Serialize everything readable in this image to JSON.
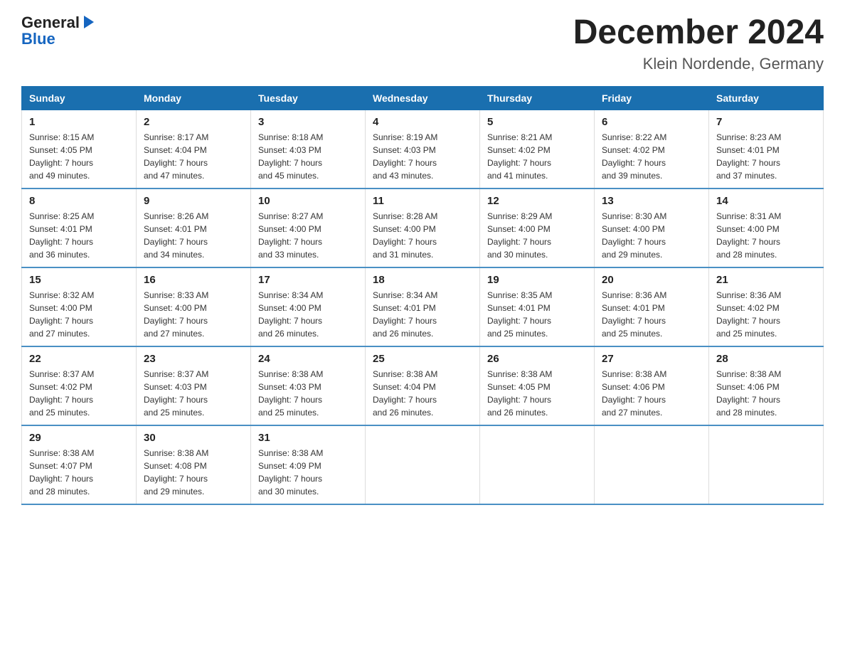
{
  "logo": {
    "general": "General",
    "arrow": "▶",
    "blue": "Blue"
  },
  "title": {
    "month_year": "December 2024",
    "location": "Klein Nordende, Germany"
  },
  "days_header": [
    "Sunday",
    "Monday",
    "Tuesday",
    "Wednesday",
    "Thursday",
    "Friday",
    "Saturday"
  ],
  "weeks": [
    [
      {
        "day": "1",
        "sunrise": "8:15 AM",
        "sunset": "4:05 PM",
        "daylight": "7 hours and 49 minutes."
      },
      {
        "day": "2",
        "sunrise": "8:17 AM",
        "sunset": "4:04 PM",
        "daylight": "7 hours and 47 minutes."
      },
      {
        "day": "3",
        "sunrise": "8:18 AM",
        "sunset": "4:03 PM",
        "daylight": "7 hours and 45 minutes."
      },
      {
        "day": "4",
        "sunrise": "8:19 AM",
        "sunset": "4:03 PM",
        "daylight": "7 hours and 43 minutes."
      },
      {
        "day": "5",
        "sunrise": "8:21 AM",
        "sunset": "4:02 PM",
        "daylight": "7 hours and 41 minutes."
      },
      {
        "day": "6",
        "sunrise": "8:22 AM",
        "sunset": "4:02 PM",
        "daylight": "7 hours and 39 minutes."
      },
      {
        "day": "7",
        "sunrise": "8:23 AM",
        "sunset": "4:01 PM",
        "daylight": "7 hours and 37 minutes."
      }
    ],
    [
      {
        "day": "8",
        "sunrise": "8:25 AM",
        "sunset": "4:01 PM",
        "daylight": "7 hours and 36 minutes."
      },
      {
        "day": "9",
        "sunrise": "8:26 AM",
        "sunset": "4:01 PM",
        "daylight": "7 hours and 34 minutes."
      },
      {
        "day": "10",
        "sunrise": "8:27 AM",
        "sunset": "4:00 PM",
        "daylight": "7 hours and 33 minutes."
      },
      {
        "day": "11",
        "sunrise": "8:28 AM",
        "sunset": "4:00 PM",
        "daylight": "7 hours and 31 minutes."
      },
      {
        "day": "12",
        "sunrise": "8:29 AM",
        "sunset": "4:00 PM",
        "daylight": "7 hours and 30 minutes."
      },
      {
        "day": "13",
        "sunrise": "8:30 AM",
        "sunset": "4:00 PM",
        "daylight": "7 hours and 29 minutes."
      },
      {
        "day": "14",
        "sunrise": "8:31 AM",
        "sunset": "4:00 PM",
        "daylight": "7 hours and 28 minutes."
      }
    ],
    [
      {
        "day": "15",
        "sunrise": "8:32 AM",
        "sunset": "4:00 PM",
        "daylight": "7 hours and 27 minutes."
      },
      {
        "day": "16",
        "sunrise": "8:33 AM",
        "sunset": "4:00 PM",
        "daylight": "7 hours and 27 minutes."
      },
      {
        "day": "17",
        "sunrise": "8:34 AM",
        "sunset": "4:00 PM",
        "daylight": "7 hours and 26 minutes."
      },
      {
        "day": "18",
        "sunrise": "8:34 AM",
        "sunset": "4:01 PM",
        "daylight": "7 hours and 26 minutes."
      },
      {
        "day": "19",
        "sunrise": "8:35 AM",
        "sunset": "4:01 PM",
        "daylight": "7 hours and 25 minutes."
      },
      {
        "day": "20",
        "sunrise": "8:36 AM",
        "sunset": "4:01 PM",
        "daylight": "7 hours and 25 minutes."
      },
      {
        "day": "21",
        "sunrise": "8:36 AM",
        "sunset": "4:02 PM",
        "daylight": "7 hours and 25 minutes."
      }
    ],
    [
      {
        "day": "22",
        "sunrise": "8:37 AM",
        "sunset": "4:02 PM",
        "daylight": "7 hours and 25 minutes."
      },
      {
        "day": "23",
        "sunrise": "8:37 AM",
        "sunset": "4:03 PM",
        "daylight": "7 hours and 25 minutes."
      },
      {
        "day": "24",
        "sunrise": "8:38 AM",
        "sunset": "4:03 PM",
        "daylight": "7 hours and 25 minutes."
      },
      {
        "day": "25",
        "sunrise": "8:38 AM",
        "sunset": "4:04 PM",
        "daylight": "7 hours and 26 minutes."
      },
      {
        "day": "26",
        "sunrise": "8:38 AM",
        "sunset": "4:05 PM",
        "daylight": "7 hours and 26 minutes."
      },
      {
        "day": "27",
        "sunrise": "8:38 AM",
        "sunset": "4:06 PM",
        "daylight": "7 hours and 27 minutes."
      },
      {
        "day": "28",
        "sunrise": "8:38 AM",
        "sunset": "4:06 PM",
        "daylight": "7 hours and 28 minutes."
      }
    ],
    [
      {
        "day": "29",
        "sunrise": "8:38 AM",
        "sunset": "4:07 PM",
        "daylight": "7 hours and 28 minutes."
      },
      {
        "day": "30",
        "sunrise": "8:38 AM",
        "sunset": "4:08 PM",
        "daylight": "7 hours and 29 minutes."
      },
      {
        "day": "31",
        "sunrise": "8:38 AM",
        "sunset": "4:09 PM",
        "daylight": "7 hours and 30 minutes."
      },
      null,
      null,
      null,
      null
    ]
  ]
}
